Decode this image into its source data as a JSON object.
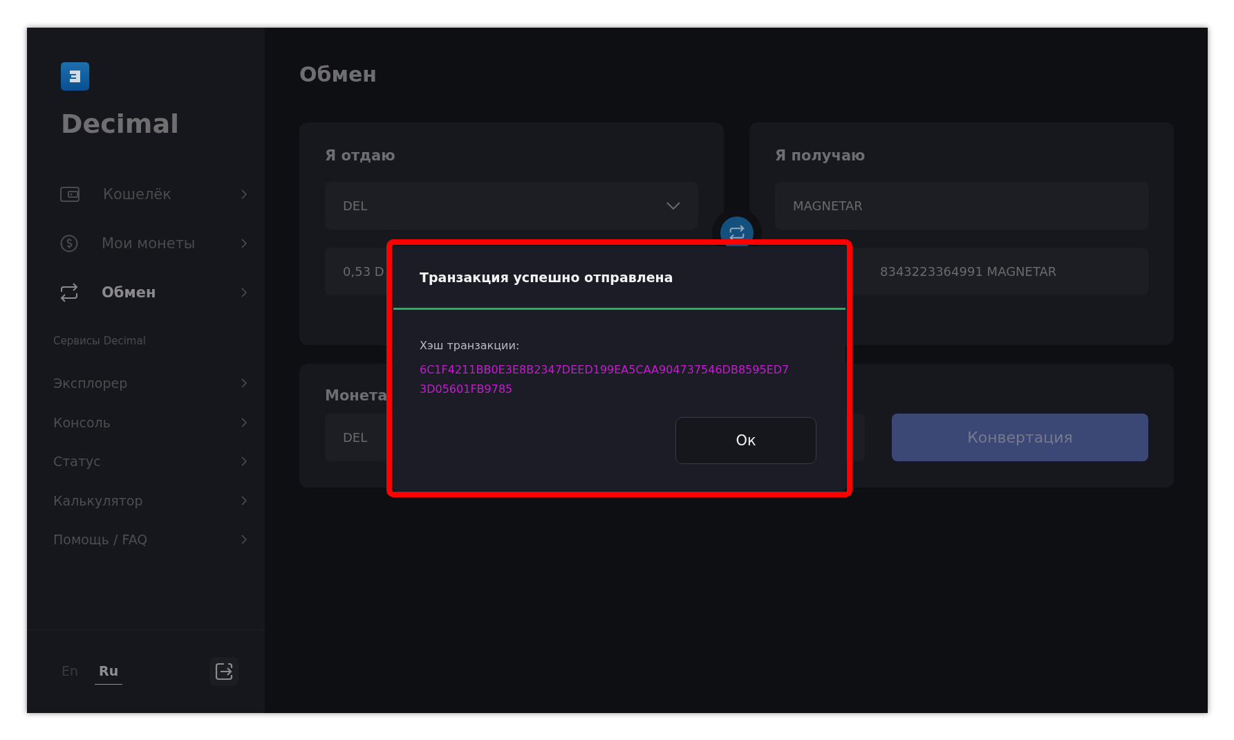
{
  "brand": "Decimal",
  "nav": [
    {
      "label": "Кошелёк",
      "kind": "wallet",
      "selected": false
    },
    {
      "label": "Мои монеты",
      "kind": "coin",
      "selected": false
    },
    {
      "label": "Обмен",
      "kind": "swap",
      "selected": true
    }
  ],
  "services_title": "Сервисы Decimal",
  "services": [
    "Эксплорер",
    "Консоль",
    "Статус",
    "Калькулятор",
    "Помощь / FAQ"
  ],
  "languages": [
    {
      "label": "En",
      "selected": false
    },
    {
      "label": "Ru",
      "selected": true
    }
  ],
  "page_title": "Обмен",
  "give": {
    "title": "Я отдаю",
    "coin": "DEL",
    "amount": "0,53 D"
  },
  "receive": {
    "title": "Я получаю",
    "coin": "MAGNETAR",
    "amount": "8343223364991 MAGNETAR"
  },
  "fee": {
    "label": "Монета",
    "coin": "DEL"
  },
  "convert_button": "Конвертация",
  "dialog": {
    "title": "Транзакция успешно отправлена",
    "hash_label": "Хэш транзакции:",
    "hash": "6C1F4211BB0E3E8B2347DEED199EA5CAA904737546DB8595ED73D05601FB9785",
    "ok": "Ок"
  }
}
